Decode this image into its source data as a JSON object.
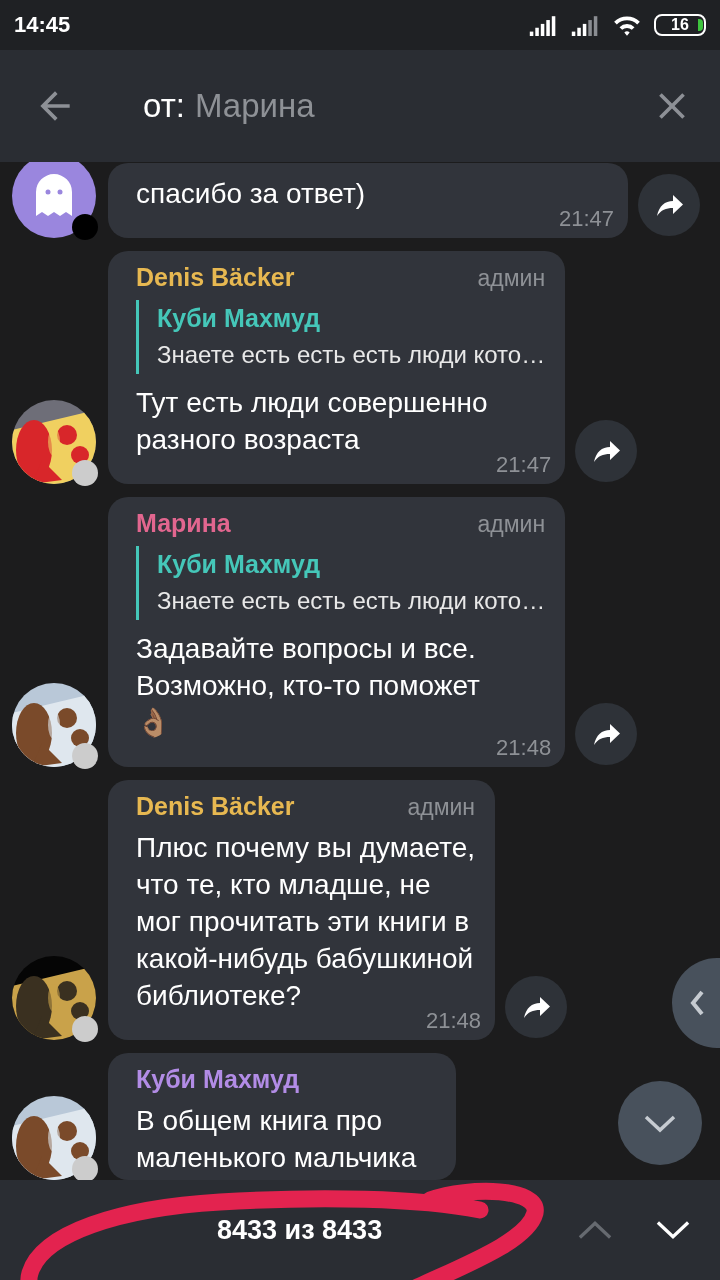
{
  "status_bar": {
    "time": "14:45",
    "battery": "16"
  },
  "search": {
    "prefix": "от:",
    "value": "Марина"
  },
  "messages": [
    {
      "avatar": {
        "kind": "ghost"
      },
      "status": {
        "color": "#000000"
      },
      "text": "спасибо за ответ)",
      "time": "21:47"
    },
    {
      "status": {
        "color": "#cccccc"
      },
      "sender": {
        "name": "Denis Bäcker",
        "color": "#e7b851"
      },
      "role": "админ",
      "reply": {
        "name": "Куби Махмуд",
        "text": "Знаете есть есть есть люди кото…"
      },
      "text": "Тут есть люди совершенно\nразного возраста",
      "time": "21:47"
    },
    {
      "status": {
        "color": "#cccccc"
      },
      "sender": {
        "name": "Марина",
        "color": "#e2668f"
      },
      "role": "админ",
      "reply": {
        "name": "Куби Махмуд",
        "text": "Знаете есть есть есть люди кото…"
      },
      "text": "Задавайте вопросы и все.\nВозможно, кто-то поможет\n👌🏽",
      "time": "21:48"
    },
    {
      "status": {
        "color": "#cccccc"
      },
      "sender": {
        "name": "Denis Bäcker",
        "color": "#e7b851"
      },
      "role": "админ",
      "text": "Плюс почему вы думаете,\nчто те, кто младше, не\nмог прочитать эти книги в\nкакой-нибудь бабушкиной\nбиблиотеке?",
      "time": "21:48"
    },
    {
      "status": {
        "color": "#cccccc"
      },
      "sender": {
        "name": "Куби Махмуд",
        "color": "#b28ce6"
      },
      "text": "В общем книга про\nмаленького мальчика"
    }
  ],
  "results": {
    "counter": "8433 из 8433",
    "up_disabled": true,
    "down_disabled": false
  }
}
